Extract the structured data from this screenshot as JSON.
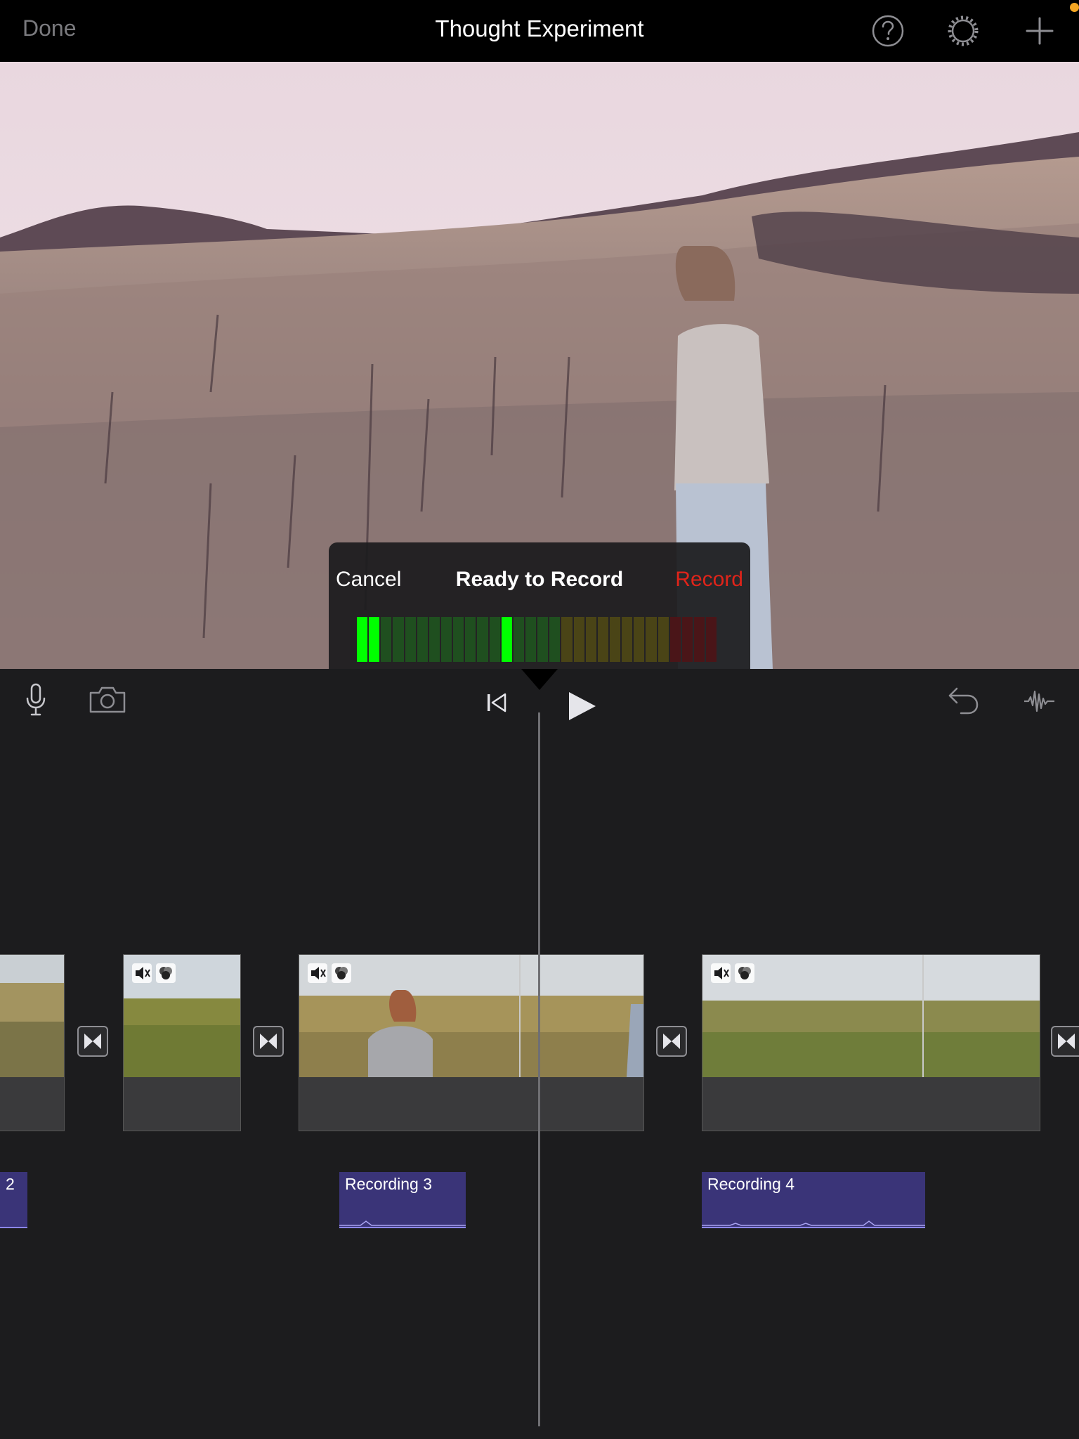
{
  "header": {
    "done_label": "Done",
    "title": "Thought Experiment",
    "help_icon": "question-circle-icon",
    "settings_icon": "gear-icon",
    "add_icon": "plus-icon"
  },
  "record_panel": {
    "cancel_label": "Cancel",
    "status": "Ready to Record",
    "record_label": "Record",
    "meter_segments": 30,
    "meter_active_segments": [
      0,
      1,
      12
    ]
  },
  "controls": {
    "mic_icon": "microphone-icon",
    "camera_icon": "camera-icon",
    "skip_back_icon": "skip-to-start-icon",
    "play_icon": "play-icon",
    "undo_icon": "undo-icon",
    "audio_icon": "waveform-icon"
  },
  "timeline": {
    "audio_clips": [
      {
        "label": "2"
      },
      {
        "label": "Recording 3"
      },
      {
        "label": "Recording 4"
      }
    ]
  },
  "colors": {
    "record_red": "#e0241a",
    "meter_green": "#00ff00",
    "audio_clip": "#3a3478"
  }
}
